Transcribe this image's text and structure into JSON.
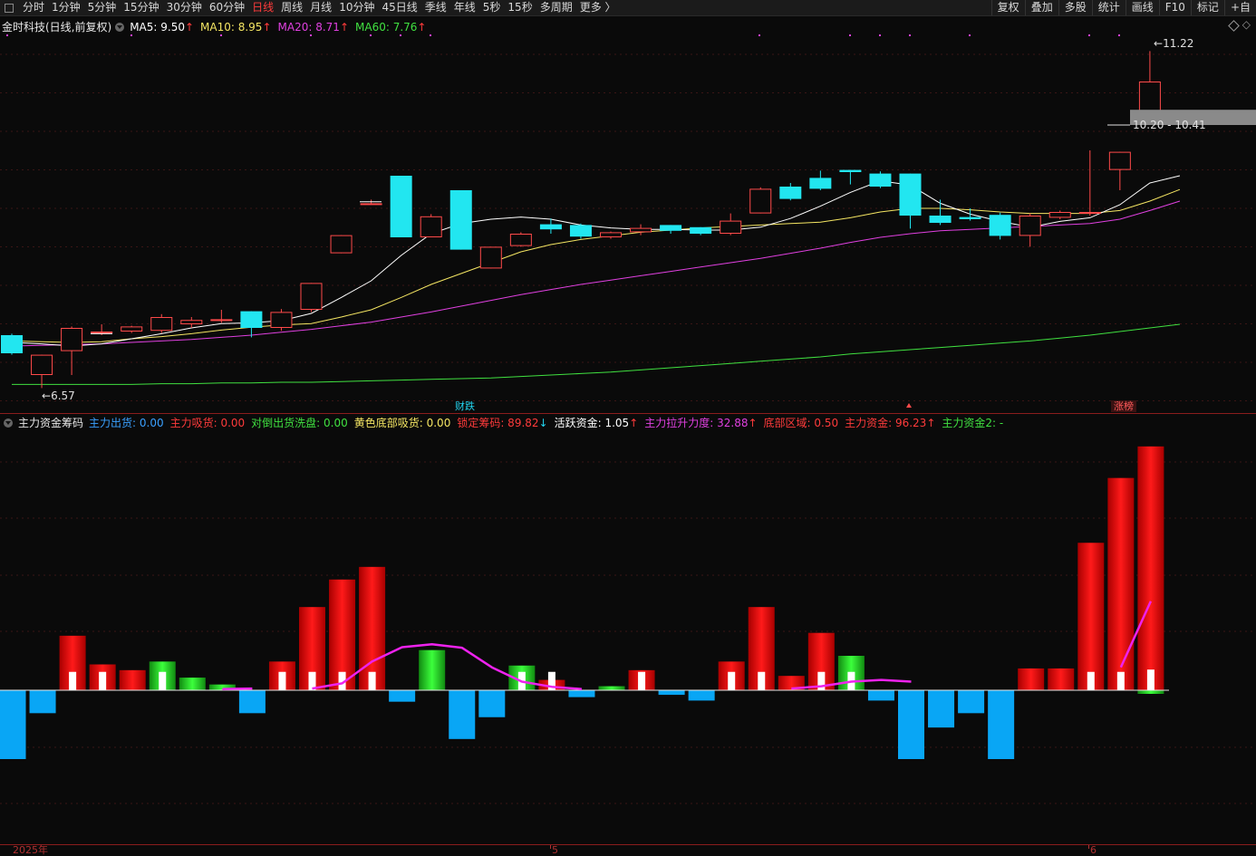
{
  "toolbar": {
    "tabs": [
      {
        "label": "分时",
        "active": false
      },
      {
        "label": "1分钟",
        "active": false
      },
      {
        "label": "5分钟",
        "active": false
      },
      {
        "label": "15分钟",
        "active": false
      },
      {
        "label": "30分钟",
        "active": false
      },
      {
        "label": "60分钟",
        "active": false
      },
      {
        "label": "日线",
        "active": true
      },
      {
        "label": "周线",
        "active": false
      },
      {
        "label": "月线",
        "active": false
      },
      {
        "label": "10分钟",
        "active": false
      },
      {
        "label": "45日线",
        "active": false
      },
      {
        "label": "季线",
        "active": false
      },
      {
        "label": "年线",
        "active": false
      },
      {
        "label": "5秒",
        "active": false
      },
      {
        "label": "15秒",
        "active": false
      },
      {
        "label": "多周期",
        "active": false
      },
      {
        "label": "更多 〉",
        "active": false
      }
    ],
    "right_tabs": [
      "复权",
      "叠加",
      "多股",
      "统计",
      "画线",
      "F10",
      "标记",
      "+自"
    ]
  },
  "price_legend": {
    "title": "金时科技(日线,前复权)",
    "ma": [
      {
        "label": "MA5: 9.50",
        "arrow": "↑",
        "color": "#ffffff"
      },
      {
        "label": "MA10: 8.95",
        "arrow": "↑",
        "color": "#f5e663"
      },
      {
        "label": "MA20: 8.71",
        "arrow": "↑",
        "color": "#e040e0"
      },
      {
        "label": "MA60: 7.76",
        "arrow": "↑",
        "color": "#40e040"
      }
    ]
  },
  "price_annotations": {
    "high_label": "11.22",
    "low_label": "6.57",
    "range_label": "10.20 - 10.41"
  },
  "event_tags": [
    {
      "label": "财跌",
      "color": "#22d3ee"
    },
    {
      "label": "涨榜",
      "color": "#ff5a5a"
    }
  ],
  "ind_legend": {
    "title": "主力资金筹码",
    "items": [
      {
        "label": "主力出货: 0.00",
        "arrow": "",
        "color": "#3aa0ff"
      },
      {
        "label": "主力吸货: 0.00",
        "arrow": "",
        "color": "#ff3b3b"
      },
      {
        "label": "对倒出货洗盘: 0.00",
        "arrow": "",
        "color": "#40e040"
      },
      {
        "label": "黄色底部吸货: 0.00",
        "arrow": "",
        "color": "#f5e663"
      },
      {
        "label": "锁定筹码: 89.82",
        "arrow": "↓",
        "color": "#ff3b3b"
      },
      {
        "label": "活跃资金: 1.05",
        "arrow": "↑",
        "color": "#ffffff"
      },
      {
        "label": "主力拉升力度: 32.88",
        "arrow": "↑",
        "color": "#e040e0"
      },
      {
        "label": "底部区域: 0.50",
        "arrow": "",
        "color": "#ff3b3b"
      },
      {
        "label": "主力资金: 96.23",
        "arrow": "↑",
        "color": "#ff3b3b"
      },
      {
        "label": "主力资金2: -",
        "arrow": "",
        "color": "#40e040"
      }
    ]
  },
  "time_axis": {
    "labels": [
      "2025年",
      "5",
      "6"
    ]
  },
  "chart_data": {
    "type": "candlestick",
    "price_range": [
      6.3,
      11.6
    ],
    "candles": [
      {
        "o": 7.3,
        "h": 7.32,
        "l": 7.03,
        "c": 7.05
      },
      {
        "o": 6.75,
        "h": 7.03,
        "l": 6.57,
        "c": 7.03
      },
      {
        "o": 7.08,
        "h": 7.42,
        "l": 6.75,
        "c": 7.4
      },
      {
        "o": 7.35,
        "h": 7.45,
        "l": 7.3,
        "c": 7.35
      },
      {
        "o": 7.35,
        "h": 7.43,
        "l": 7.33,
        "c": 7.42
      },
      {
        "o": 7.36,
        "h": 7.59,
        "l": 7.33,
        "c": 7.55
      },
      {
        "o": 7.45,
        "h": 7.55,
        "l": 7.4,
        "c": 7.51
      },
      {
        "o": 7.5,
        "h": 7.65,
        "l": 7.47,
        "c": 7.52
      },
      {
        "o": 7.63,
        "h": 7.63,
        "l": 7.27,
        "c": 7.4
      },
      {
        "o": 7.4,
        "h": 7.66,
        "l": 7.36,
        "c": 7.62
      },
      {
        "o": 7.65,
        "h": 8.02,
        "l": 7.62,
        "c": 8.02
      },
      {
        "o": 8.43,
        "h": 8.68,
        "l": 8.43,
        "c": 8.68
      },
      {
        "o": 9.1,
        "h": 9.17,
        "l": 9.1,
        "c": 9.12
      },
      {
        "o": 9.5,
        "h": 9.5,
        "l": 8.65,
        "c": 8.65
      },
      {
        "o": 8.65,
        "h": 8.97,
        "l": 8.65,
        "c": 8.94
      },
      {
        "o": 9.3,
        "h": 9.3,
        "l": 8.48,
        "c": 8.48
      },
      {
        "o": 8.22,
        "h": 8.52,
        "l": 8.22,
        "c": 8.52
      },
      {
        "o": 8.53,
        "h": 8.72,
        "l": 8.52,
        "c": 8.7
      },
      {
        "o": 8.83,
        "h": 8.91,
        "l": 8.7,
        "c": 8.76
      },
      {
        "o": 8.82,
        "h": 8.84,
        "l": 8.63,
        "c": 8.66
      },
      {
        "o": 8.65,
        "h": 8.73,
        "l": 8.63,
        "c": 8.72
      },
      {
        "o": 8.72,
        "h": 8.83,
        "l": 8.68,
        "c": 8.78
      },
      {
        "o": 8.82,
        "h": 8.82,
        "l": 8.7,
        "c": 8.74
      },
      {
        "o": 8.79,
        "h": 8.79,
        "l": 8.68,
        "c": 8.7
      },
      {
        "o": 8.7,
        "h": 8.98,
        "l": 8.68,
        "c": 8.88
      },
      {
        "o": 8.98,
        "h": 9.34,
        "l": 8.98,
        "c": 9.32
      },
      {
        "o": 9.35,
        "h": 9.4,
        "l": 9.16,
        "c": 9.18
      },
      {
        "o": 9.47,
        "h": 9.57,
        "l": 9.3,
        "c": 9.32
      },
      {
        "o": 9.58,
        "h": 9.58,
        "l": 9.38,
        "c": 9.55
      },
      {
        "o": 9.53,
        "h": 9.56,
        "l": 9.33,
        "c": 9.35
      },
      {
        "o": 9.53,
        "h": 9.53,
        "l": 8.77,
        "c": 8.95
      },
      {
        "o": 8.95,
        "h": 9.17,
        "l": 8.82,
        "c": 8.85
      },
      {
        "o": 8.93,
        "h": 9.05,
        "l": 8.88,
        "c": 8.9
      },
      {
        "o": 8.96,
        "h": 8.99,
        "l": 8.62,
        "c": 8.67
      },
      {
        "o": 8.67,
        "h": 8.98,
        "l": 8.52,
        "c": 8.95
      },
      {
        "o": 8.92,
        "h": 9.02,
        "l": 8.9,
        "c": 9.0
      },
      {
        "o": 9.0,
        "h": 9.85,
        "l": 8.95,
        "c": 9.0
      },
      {
        "o": 9.58,
        "h": 9.83,
        "l": 9.3,
        "c": 9.83
      },
      {
        "o": 10.32,
        "h": 11.22,
        "l": 10.2,
        "c": 10.8
      }
    ],
    "ma5": [
      7.2,
      7.18,
      7.15,
      7.18,
      7.25,
      7.32,
      7.4,
      7.46,
      7.47,
      7.5,
      7.6,
      7.82,
      8.05,
      8.4,
      8.7,
      8.84,
      8.9,
      8.93,
      8.9,
      8.82,
      8.78,
      8.76,
      8.76,
      8.75,
      8.75,
      8.79,
      8.91,
      9.08,
      9.27,
      9.43,
      9.37,
      9.12,
      8.97,
      8.87,
      8.79,
      8.87,
      8.92,
      9.1,
      9.4,
      9.5
    ],
    "ma10": [
      7.22,
      7.21,
      7.2,
      7.21,
      7.25,
      7.28,
      7.32,
      7.37,
      7.41,
      7.44,
      7.46,
      7.55,
      7.65,
      7.82,
      8.0,
      8.15,
      8.3,
      8.45,
      8.55,
      8.62,
      8.67,
      8.72,
      8.75,
      8.78,
      8.8,
      8.82,
      8.84,
      8.86,
      8.92,
      9.0,
      9.05,
      9.05,
      9.03,
      9.0,
      8.98,
      8.98,
      8.98,
      9.02,
      9.15,
      9.31
    ],
    "ma20": [
      7.15,
      7.16,
      7.17,
      7.18,
      7.2,
      7.22,
      7.24,
      7.27,
      7.3,
      7.34,
      7.38,
      7.43,
      7.48,
      7.55,
      7.62,
      7.7,
      7.78,
      7.86,
      7.93,
      8.0,
      8.06,
      8.12,
      8.18,
      8.24,
      8.3,
      8.36,
      8.43,
      8.5,
      8.58,
      8.65,
      8.7,
      8.74,
      8.76,
      8.78,
      8.8,
      8.82,
      8.84,
      8.9,
      9.02,
      9.15
    ],
    "ma60": [
      6.62,
      6.62,
      6.62,
      6.62,
      6.62,
      6.63,
      6.63,
      6.64,
      6.64,
      6.65,
      6.65,
      6.66,
      6.67,
      6.68,
      6.69,
      6.7,
      6.71,
      6.73,
      6.75,
      6.77,
      6.79,
      6.82,
      6.85,
      6.88,
      6.91,
      6.94,
      6.97,
      7.0,
      7.04,
      7.07,
      7.1,
      7.13,
      7.16,
      7.19,
      7.22,
      7.26,
      7.3,
      7.35,
      7.4,
      7.45
    ]
  },
  "indicator_data": {
    "type": "bar",
    "value_range": [
      -12,
      45
    ],
    "bars": [
      {
        "v": -12,
        "c": "blue"
      },
      {
        "v": -4,
        "c": "blue"
      },
      {
        "v": 9.5,
        "c": "red"
      },
      {
        "v": 4.5,
        "c": "red"
      },
      {
        "v": 3.5,
        "c": "red"
      },
      {
        "v": 5,
        "c": "green"
      },
      {
        "v": 2.2,
        "c": "green"
      },
      {
        "v": 1,
        "c": "green"
      },
      {
        "v": -4,
        "c": "blue"
      },
      {
        "v": 5,
        "c": "red"
      },
      {
        "v": 14.5,
        "c": "red"
      },
      {
        "v": 19.3,
        "c": "red"
      },
      {
        "v": 21.5,
        "c": "red"
      },
      {
        "v": -2,
        "c": "blue"
      },
      {
        "v": 7,
        "c": "green"
      },
      {
        "v": -8.5,
        "c": "blue"
      },
      {
        "v": -4.7,
        "c": "blue"
      },
      {
        "v": 4.3,
        "c": "green"
      },
      {
        "v": 1.8,
        "c": "red"
      },
      {
        "v": -1.2,
        "c": "blue"
      },
      {
        "v": 0.7,
        "c": "green"
      },
      {
        "v": 3.5,
        "c": "red"
      },
      {
        "v": -0.8,
        "c": "blue"
      },
      {
        "v": -1.8,
        "c": "blue"
      },
      {
        "v": 5,
        "c": "red"
      },
      {
        "v": 14.5,
        "c": "red"
      },
      {
        "v": 2.5,
        "c": "red"
      },
      {
        "v": 10,
        "c": "red"
      },
      {
        "v": 6,
        "c": "green"
      },
      {
        "v": -1.8,
        "c": "blue"
      },
      {
        "v": -12,
        "c": "blue"
      },
      {
        "v": -6.5,
        "c": "blue"
      },
      {
        "v": -4,
        "c": "blue"
      },
      {
        "v": -12,
        "c": "blue"
      },
      {
        "v": 3.8,
        "c": "red"
      },
      {
        "v": 3.8,
        "c": "red"
      },
      {
        "v": 25.7,
        "c": "red"
      },
      {
        "v": 37,
        "c": "red"
      },
      {
        "v": 42.5,
        "c": "red"
      }
    ],
    "white_bars": [
      0,
      0,
      3.2,
      3.2,
      0,
      3.2,
      0,
      0,
      0,
      3.2,
      3.2,
      3.2,
      3.2,
      0,
      0,
      0,
      0,
      3.2,
      3.2,
      0,
      0,
      3.2,
      0,
      0,
      3.2,
      3.2,
      0,
      3.2,
      3.2,
      0,
      0,
      0,
      0,
      0,
      0,
      0,
      3.2,
      3.2,
      3.6
    ],
    "magenta_segments": [
      [
        [
          7,
          0.2
        ],
        [
          8,
          0.3
        ]
      ],
      [
        [
          10,
          0.3
        ],
        [
          11,
          1.2
        ],
        [
          12,
          5
        ],
        [
          13,
          7.5
        ],
        [
          14,
          8
        ],
        [
          15,
          7.4
        ],
        [
          16,
          4
        ],
        [
          17,
          1.5
        ],
        [
          18,
          0.6
        ],
        [
          19,
          0.2
        ]
      ],
      [
        [
          26,
          0.3
        ],
        [
          27,
          0.7
        ],
        [
          28,
          1.5
        ],
        [
          29,
          1.8
        ],
        [
          30,
          1.5
        ]
      ],
      [
        [
          37,
          4
        ],
        [
          38,
          15.5
        ]
      ]
    ]
  }
}
